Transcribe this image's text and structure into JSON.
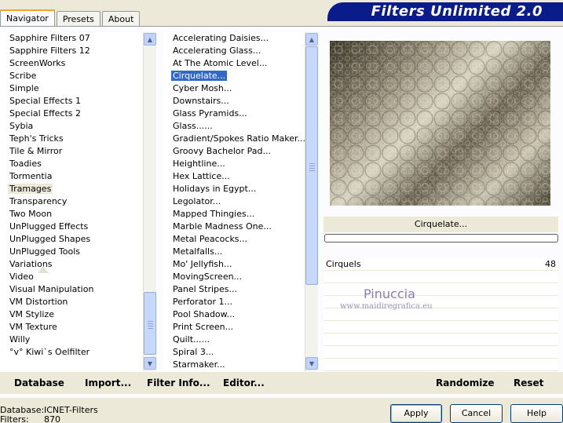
{
  "tabs": [
    "Navigator",
    "Presets",
    "About"
  ],
  "banner": "Filters Unlimited 2.0",
  "categories": [
    "Sapphire Filters 07",
    "Sapphire Filters 12",
    "ScreenWorks",
    "Scribe",
    "Simple",
    "Special Effects 1",
    "Special Effects 2",
    "Sybia",
    "Teph's Tricks",
    "Tile & Mirror",
    "Toadies",
    "Tormentia",
    "Tramages",
    "Transparency",
    "Two Moon",
    "UnPlugged Effects",
    "UnPlugged Shapes",
    "UnPlugged Tools",
    "Variations",
    "Video",
    "Visual Manipulation",
    "VM Distortion",
    "VM Stylize",
    "VM Texture",
    "Willy",
    "°v° Kiwi`s Oelfilter"
  ],
  "selected_category": "Tramages",
  "filters": [
    "Accelerating Daisies...",
    "Accelerating Glass...",
    "At The Atomic Level...",
    "Cirquelate...",
    "Cyber Mosh...",
    "Downstairs...",
    "Glass Pyramids...",
    "Glass......",
    "Gradient/Spokes Ratio Maker...",
    "Groovy Bachelor Pad...",
    "Heightline...",
    "Hex Lattice...",
    "Holidays in Egypt...",
    "Legolator...",
    "Mapped Thingies...",
    "Marble Madness One...",
    "Metal Peacocks...",
    "Metalfalls...",
    "Mo' Jellyfish...",
    "MovingScreen...",
    "Panel Stripes...",
    "Perforator 1...",
    "Pool Shadow...",
    "Print Screen...",
    "Quilt......",
    "Spiral 3...",
    "Starmaker..."
  ],
  "selected_filter": "Cirquelate...",
  "current_filter_label": "Cirquelate...",
  "progress": 0,
  "params": [
    {
      "name": "Cirquels",
      "value": "48"
    }
  ],
  "watermark": {
    "name": "Pinuccia",
    "url": "www.maidiregrafica.eu"
  },
  "toolbar": {
    "database": "Database",
    "import": "Import...",
    "filter_info": "Filter Info...",
    "editor": "Editor...",
    "randomize": "Randomize",
    "reset": "Reset"
  },
  "status": {
    "database_label": "Database:",
    "database_value": "ICNET-Filters",
    "filters_label": "Filters:",
    "filters_value": "870"
  },
  "buttons": {
    "apply": "Apply",
    "cancel": "Cancel",
    "help": "Help"
  },
  "colors": {
    "banner": "#0a1b8a",
    "selection": "#316ac5",
    "face": "#ece9d8"
  }
}
